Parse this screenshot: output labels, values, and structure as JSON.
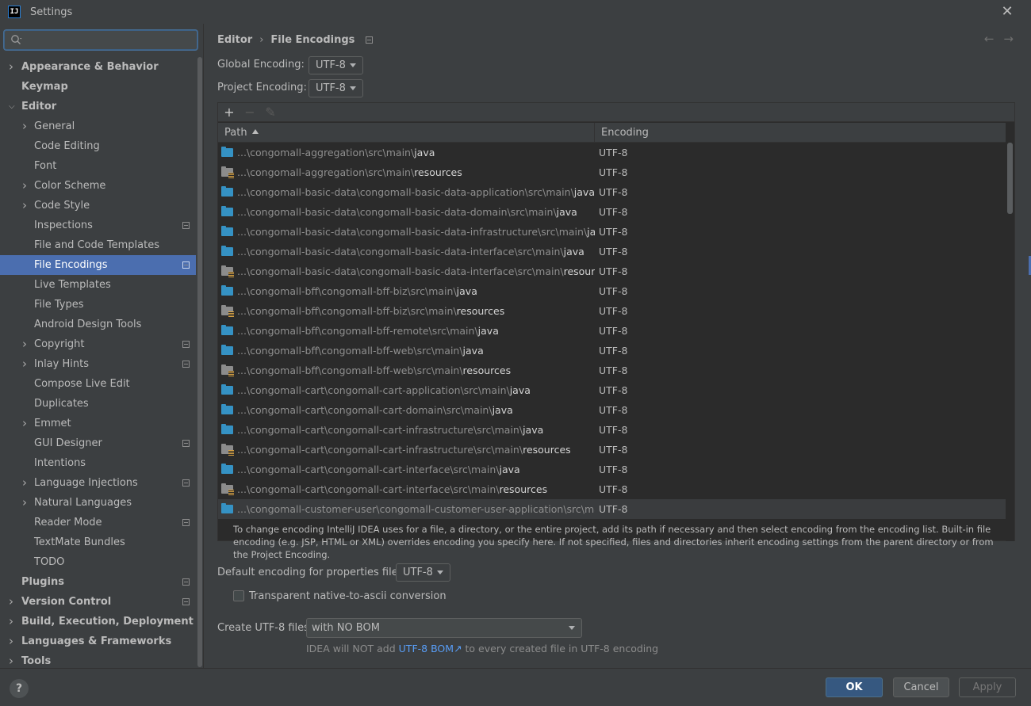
{
  "window": {
    "title": "Settings",
    "app_icon_text": "IJ"
  },
  "search": {
    "placeholder": ""
  },
  "sidebar": {
    "items": [
      {
        "label": "Appearance & Behavior",
        "level": 0,
        "arrow": "right",
        "badge": false
      },
      {
        "label": "Keymap",
        "level": 0,
        "arrow": "",
        "badge": false
      },
      {
        "label": "Editor",
        "level": 0,
        "arrow": "down",
        "badge": false
      },
      {
        "label": "General",
        "level": 1,
        "arrow": "right",
        "badge": false
      },
      {
        "label": "Code Editing",
        "level": 1,
        "arrow": "",
        "badge": false
      },
      {
        "label": "Font",
        "level": 1,
        "arrow": "",
        "badge": false
      },
      {
        "label": "Color Scheme",
        "level": 1,
        "arrow": "right",
        "badge": false
      },
      {
        "label": "Code Style",
        "level": 1,
        "arrow": "right",
        "badge": false
      },
      {
        "label": "Inspections",
        "level": 1,
        "arrow": "",
        "badge": true
      },
      {
        "label": "File and Code Templates",
        "level": 1,
        "arrow": "",
        "badge": false
      },
      {
        "label": "File Encodings",
        "level": 1,
        "arrow": "",
        "badge": true,
        "selected": true
      },
      {
        "label": "Live Templates",
        "level": 1,
        "arrow": "",
        "badge": false
      },
      {
        "label": "File Types",
        "level": 1,
        "arrow": "",
        "badge": false
      },
      {
        "label": "Android Design Tools",
        "level": 1,
        "arrow": "",
        "badge": false
      },
      {
        "label": "Copyright",
        "level": 1,
        "arrow": "right",
        "badge": true
      },
      {
        "label": "Inlay Hints",
        "level": 1,
        "arrow": "right",
        "badge": true
      },
      {
        "label": "Compose Live Edit",
        "level": 1,
        "arrow": "",
        "badge": false
      },
      {
        "label": "Duplicates",
        "level": 1,
        "arrow": "",
        "badge": false
      },
      {
        "label": "Emmet",
        "level": 1,
        "arrow": "right",
        "badge": false
      },
      {
        "label": "GUI Designer",
        "level": 1,
        "arrow": "",
        "badge": true
      },
      {
        "label": "Intentions",
        "level": 1,
        "arrow": "",
        "badge": false
      },
      {
        "label": "Language Injections",
        "level": 1,
        "arrow": "right",
        "badge": true
      },
      {
        "label": "Natural Languages",
        "level": 1,
        "arrow": "right",
        "badge": false
      },
      {
        "label": "Reader Mode",
        "level": 1,
        "arrow": "",
        "badge": true
      },
      {
        "label": "TextMate Bundles",
        "level": 1,
        "arrow": "",
        "badge": false
      },
      {
        "label": "TODO",
        "level": 1,
        "arrow": "",
        "badge": false
      },
      {
        "label": "Plugins",
        "level": 0,
        "arrow": "",
        "badge": true
      },
      {
        "label": "Version Control",
        "level": 0,
        "arrow": "right",
        "badge": true
      },
      {
        "label": "Build, Execution, Deployment",
        "level": 0,
        "arrow": "right",
        "badge": false
      },
      {
        "label": "Languages & Frameworks",
        "level": 0,
        "arrow": "right",
        "badge": false
      },
      {
        "label": "Tools",
        "level": 0,
        "arrow": "right",
        "badge": false
      }
    ]
  },
  "breadcrumb": {
    "parent": "Editor",
    "separator": "›",
    "current": "File Encodings"
  },
  "global_encoding": {
    "label": "Global Encoding:",
    "value": "UTF-8"
  },
  "project_encoding": {
    "label": "Project Encoding:",
    "value": "UTF-8"
  },
  "table": {
    "columns": {
      "path": "Path",
      "encoding": "Encoding"
    },
    "rows": [
      {
        "prefix": "...\\congomall-aggregation\\src\\main\\",
        "leaf": "java",
        "type": "src",
        "encoding": "UTF-8"
      },
      {
        "prefix": "...\\congomall-aggregation\\src\\main\\",
        "leaf": "resources",
        "type": "res",
        "encoding": "UTF-8"
      },
      {
        "prefix": "...\\congomall-basic-data\\congomall-basic-data-application\\src\\main\\",
        "leaf": "java",
        "type": "src",
        "encoding": "UTF-8"
      },
      {
        "prefix": "...\\congomall-basic-data\\congomall-basic-data-domain\\src\\main\\",
        "leaf": "java",
        "type": "src",
        "encoding": "UTF-8"
      },
      {
        "prefix": "...\\congomall-basic-data\\congomall-basic-data-infrastructure\\src\\main\\",
        "leaf": "java",
        "type": "src",
        "encoding": "UTF-8"
      },
      {
        "prefix": "...\\congomall-basic-data\\congomall-basic-data-interface\\src\\main\\",
        "leaf": "java",
        "type": "src",
        "encoding": "UTF-8"
      },
      {
        "prefix": "...\\congomall-basic-data\\congomall-basic-data-interface\\src\\main\\",
        "leaf": "resources",
        "type": "res",
        "encoding": "UTF-8"
      },
      {
        "prefix": "...\\congomall-bff\\congomall-bff-biz\\src\\main\\",
        "leaf": "java",
        "type": "src",
        "encoding": "UTF-8"
      },
      {
        "prefix": "...\\congomall-bff\\congomall-bff-biz\\src\\main\\",
        "leaf": "resources",
        "type": "res",
        "encoding": "UTF-8"
      },
      {
        "prefix": "...\\congomall-bff\\congomall-bff-remote\\src\\main\\",
        "leaf": "java",
        "type": "src",
        "encoding": "UTF-8"
      },
      {
        "prefix": "...\\congomall-bff\\congomall-bff-web\\src\\main\\",
        "leaf": "java",
        "type": "src",
        "encoding": "UTF-8"
      },
      {
        "prefix": "...\\congomall-bff\\congomall-bff-web\\src\\main\\",
        "leaf": "resources",
        "type": "res",
        "encoding": "UTF-8"
      },
      {
        "prefix": "...\\congomall-cart\\congomall-cart-application\\src\\main\\",
        "leaf": "java",
        "type": "src",
        "encoding": "UTF-8"
      },
      {
        "prefix": "...\\congomall-cart\\congomall-cart-domain\\src\\main\\",
        "leaf": "java",
        "type": "src",
        "encoding": "UTF-8"
      },
      {
        "prefix": "...\\congomall-cart\\congomall-cart-infrastructure\\src\\main\\",
        "leaf": "java",
        "type": "src",
        "encoding": "UTF-8"
      },
      {
        "prefix": "...\\congomall-cart\\congomall-cart-infrastructure\\src\\main\\",
        "leaf": "resources",
        "type": "res",
        "encoding": "UTF-8"
      },
      {
        "prefix": "...\\congomall-cart\\congomall-cart-interface\\src\\main\\",
        "leaf": "java",
        "type": "src",
        "encoding": "UTF-8"
      },
      {
        "prefix": "...\\congomall-cart\\congomall-cart-interface\\src\\main\\",
        "leaf": "resources",
        "type": "res",
        "encoding": "UTF-8"
      },
      {
        "prefix": "...\\congomall-customer-user\\congomall-customer-user-application\\src\\main\\",
        "leaf": "",
        "type": "src",
        "encoding": "UTF-8"
      }
    ]
  },
  "help_text": "To change encoding IntelliJ IDEA uses for a file, a directory, or the entire project, add its path if necessary and then select encoding from the encoding list. Built-in file encoding (e.g. JSP, HTML or XML) overrides encoding you specify here. If not specified, files and directories inherit encoding settings from the parent directory or from the Project Encoding.",
  "properties_encoding": {
    "label": "Default encoding for properties files:",
    "value": "UTF-8"
  },
  "transparent_ascii": {
    "label": "Transparent native-to-ascii conversion",
    "checked": false
  },
  "create_utf8": {
    "label": "Create UTF-8 files:",
    "value": "with NO BOM"
  },
  "bom_note": {
    "before": "IDEA will NOT add ",
    "link": "UTF-8 BOM",
    "link_arrow": "↗",
    "after": " to every created file in UTF-8 encoding"
  },
  "buttons": {
    "help": "?",
    "ok": "OK",
    "cancel": "Cancel",
    "apply": "Apply"
  },
  "colors": {
    "selection": "#4b6eaf",
    "link": "#589df6",
    "src_folder": "#3592c4",
    "background": "#3c3f41"
  }
}
